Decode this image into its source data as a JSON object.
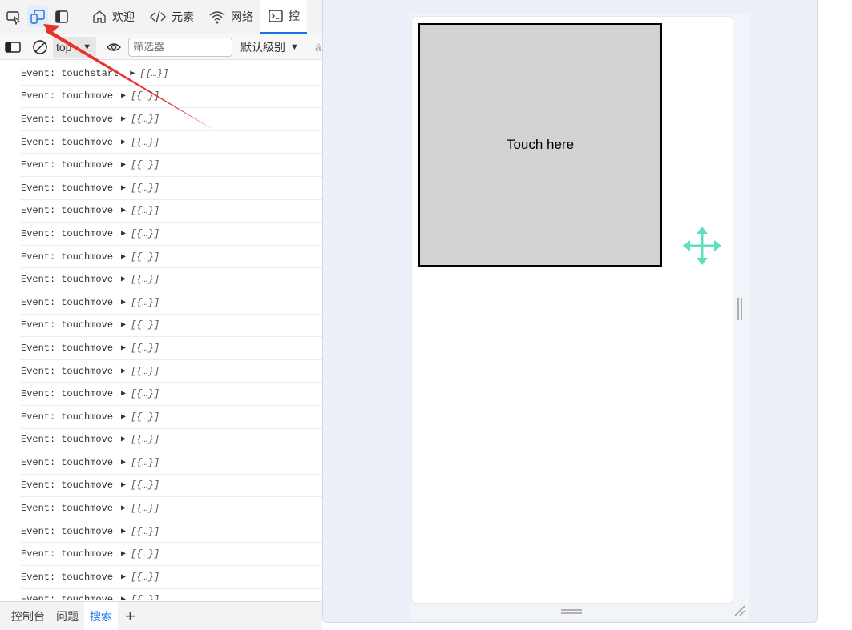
{
  "devtools": {
    "tabs": [
      {
        "label": "欢迎",
        "icon": "home-icon"
      },
      {
        "label": "元素",
        "icon": "code-icon"
      },
      {
        "label": "网络",
        "icon": "wifi-icon"
      },
      {
        "label": "控",
        "icon": "console-icon"
      }
    ],
    "top_icons": [
      "inspect-element-icon",
      "device-emulation-icon",
      "dock-side-icon"
    ],
    "toolbar": {
      "context_value": "top",
      "filter_placeholder": "筛选器",
      "level_label": "默认级别",
      "overflow_label": "ä"
    },
    "console_rows": [
      {
        "prefix": "Event:",
        "event": "touchstart",
        "object": "[{…}]"
      },
      {
        "prefix": "Event:",
        "event": "touchmove",
        "object": "[{…}]"
      },
      {
        "prefix": "Event:",
        "event": "touchmove",
        "object": "[{…}]"
      },
      {
        "prefix": "Event:",
        "event": "touchmove",
        "object": "[{…}]"
      },
      {
        "prefix": "Event:",
        "event": "touchmove",
        "object": "[{…}]"
      },
      {
        "prefix": "Event:",
        "event": "touchmove",
        "object": "[{…}]"
      },
      {
        "prefix": "Event:",
        "event": "touchmove",
        "object": "[{…}]"
      },
      {
        "prefix": "Event:",
        "event": "touchmove",
        "object": "[{…}]"
      },
      {
        "prefix": "Event:",
        "event": "touchmove",
        "object": "[{…}]"
      },
      {
        "prefix": "Event:",
        "event": "touchmove",
        "object": "[{…}]"
      },
      {
        "prefix": "Event:",
        "event": "touchmove",
        "object": "[{…}]"
      },
      {
        "prefix": "Event:",
        "event": "touchmove",
        "object": "[{…}]"
      },
      {
        "prefix": "Event:",
        "event": "touchmove",
        "object": "[{…}]"
      },
      {
        "prefix": "Event:",
        "event": "touchmove",
        "object": "[{…}]"
      },
      {
        "prefix": "Event:",
        "event": "touchmove",
        "object": "[{…}]"
      },
      {
        "prefix": "Event:",
        "event": "touchmove",
        "object": "[{…}]"
      },
      {
        "prefix": "Event:",
        "event": "touchmove",
        "object": "[{…}]"
      },
      {
        "prefix": "Event:",
        "event": "touchmove",
        "object": "[{…}]"
      },
      {
        "prefix": "Event:",
        "event": "touchmove",
        "object": "[{…}]"
      },
      {
        "prefix": "Event:",
        "event": "touchmove",
        "object": "[{…}]"
      },
      {
        "prefix": "Event:",
        "event": "touchmove",
        "object": "[{…}]"
      },
      {
        "prefix": "Event:",
        "event": "touchmove",
        "object": "[{…}]"
      },
      {
        "prefix": "Event:",
        "event": "touchmove",
        "object": "[{…}]"
      },
      {
        "prefix": "Event:",
        "event": "touchmove",
        "object": "[{…}]"
      }
    ],
    "drawer_tabs": [
      {
        "label": "控制台",
        "selected": false
      },
      {
        "label": "问题",
        "selected": false
      },
      {
        "label": "搜索",
        "selected": true
      }
    ],
    "drawer_add_label": "+"
  },
  "device": {
    "touch_box_label": "Touch here"
  },
  "colors": {
    "accent": "#1a73e8",
    "annotation_arrow": "#e8312a",
    "move_cursor": "#5ce0c0",
    "touch_box_fill": "#d3d3d3"
  }
}
